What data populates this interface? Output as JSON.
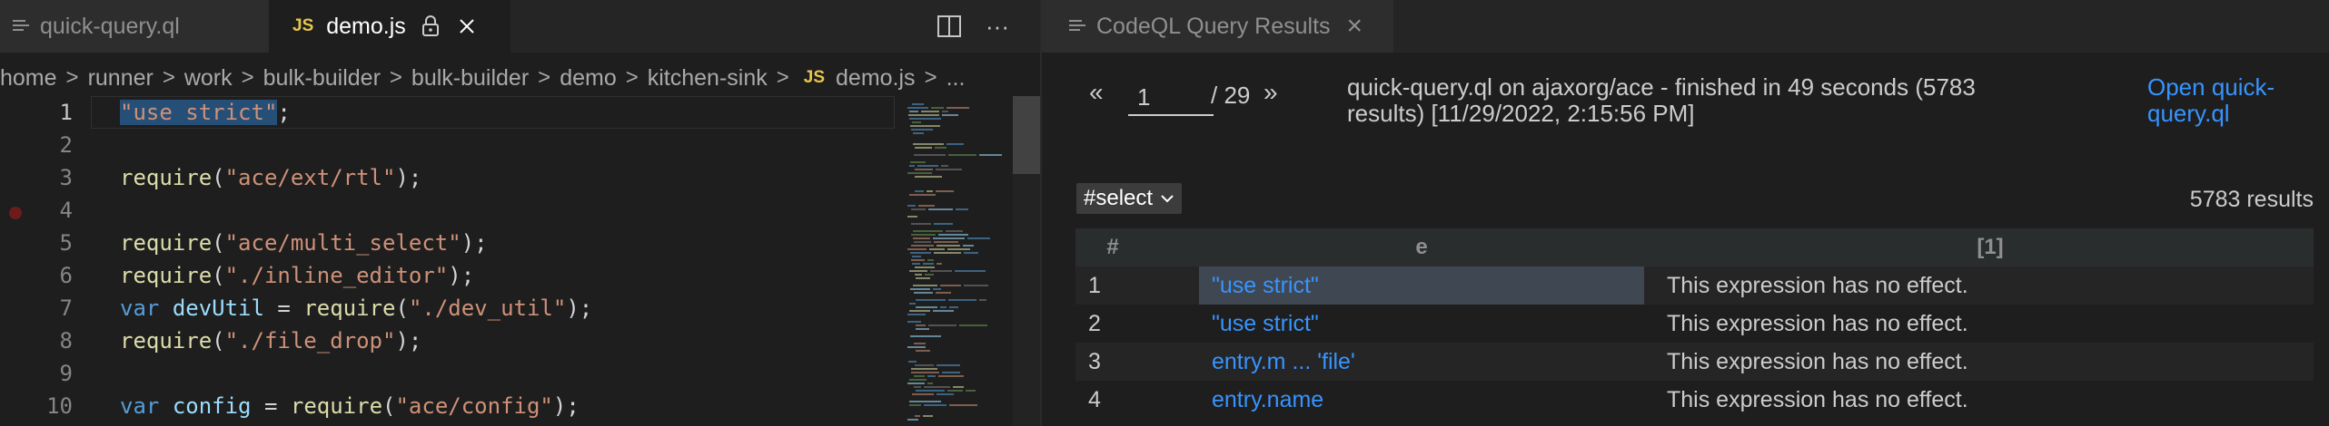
{
  "left_pane": {
    "tabs": [
      {
        "label": "quick-query.ql",
        "icon": "lines-icon",
        "active": false
      },
      {
        "label": "demo.js",
        "icon": "js-icon",
        "icon_text": "JS",
        "active": true
      }
    ],
    "toolbar": {
      "split_icon": "▯",
      "more_icon": "···"
    },
    "breadcrumb": [
      "home",
      "runner",
      "work",
      "bulk-builder",
      "bulk-builder",
      "demo",
      "kitchen-sink"
    ],
    "breadcrumb_file_icon": "JS",
    "breadcrumb_file": "demo.js",
    "breadcrumb_tail": "...",
    "breadcrumb_separator": ">",
    "editor": {
      "line_numbers": [
        "1",
        "2",
        "3",
        "4",
        "5",
        "6",
        "7",
        "8",
        "9",
        "10"
      ],
      "lines": {
        "l1_str": "\"use strict\"",
        "l1_tail": ";",
        "l3_fn": "require",
        "l3_open": "(",
        "l3_str": "\"ace/ext/rtl\"",
        "l3_close": ");",
        "l5_fn": "require",
        "l5_open": "(",
        "l5_str": "\"ace/multi_select\"",
        "l5_close": ");",
        "l6_fn": "require",
        "l6_open": "(",
        "l6_str": "\"./inline_editor\"",
        "l6_close": ");",
        "l7_kw": "var",
        "l7_var": "devUtil",
        "l7_eq": " = ",
        "l7_fn": "require",
        "l7_open": "(",
        "l7_str": "\"./dev_util\"",
        "l7_close": ");",
        "l8_fn": "require",
        "l8_open": "(",
        "l8_str": "\"./file_drop\"",
        "l8_close": ");",
        "l10_kw": "var",
        "l10_var": "config",
        "l10_eq": " = ",
        "l10_fn": "require",
        "l10_open": "(",
        "l10_str": "\"ace/config\"",
        "l10_close": ");"
      }
    }
  },
  "right_pane": {
    "tab": {
      "label": "CodeQL Query Results",
      "icon": "lines-icon",
      "close": "×"
    },
    "pager": {
      "prev": "«",
      "page": "1",
      "total": "/ 29",
      "next": "»"
    },
    "summary": "quick-query.ql on ajaxorg/ace - finished in 49 seconds (5783 results) [11/29/2022, 2:15:56 PM]",
    "open_link": "Open quick-query.ql",
    "select_label": "#select",
    "result_count": "5783 results",
    "table": {
      "headers": [
        "#",
        "e",
        "[1]"
      ],
      "rows": [
        {
          "num": "1",
          "expr": "\"use strict\"",
          "msg": "This expression has no effect."
        },
        {
          "num": "2",
          "expr": "\"use strict\"",
          "msg": "This expression has no effect."
        },
        {
          "num": "3",
          "expr": "entry.m ...  'file'",
          "msg": "This expression has no effect."
        },
        {
          "num": "4",
          "expr": "entry.name",
          "msg": "This expression has no effect."
        }
      ]
    }
  },
  "colors": {
    "string": "#ce9178",
    "function": "#dcdcaa",
    "keyword": "#569cd6",
    "variable": "#9cdcfe",
    "link": "#3794ff",
    "selection": "#264f78"
  }
}
